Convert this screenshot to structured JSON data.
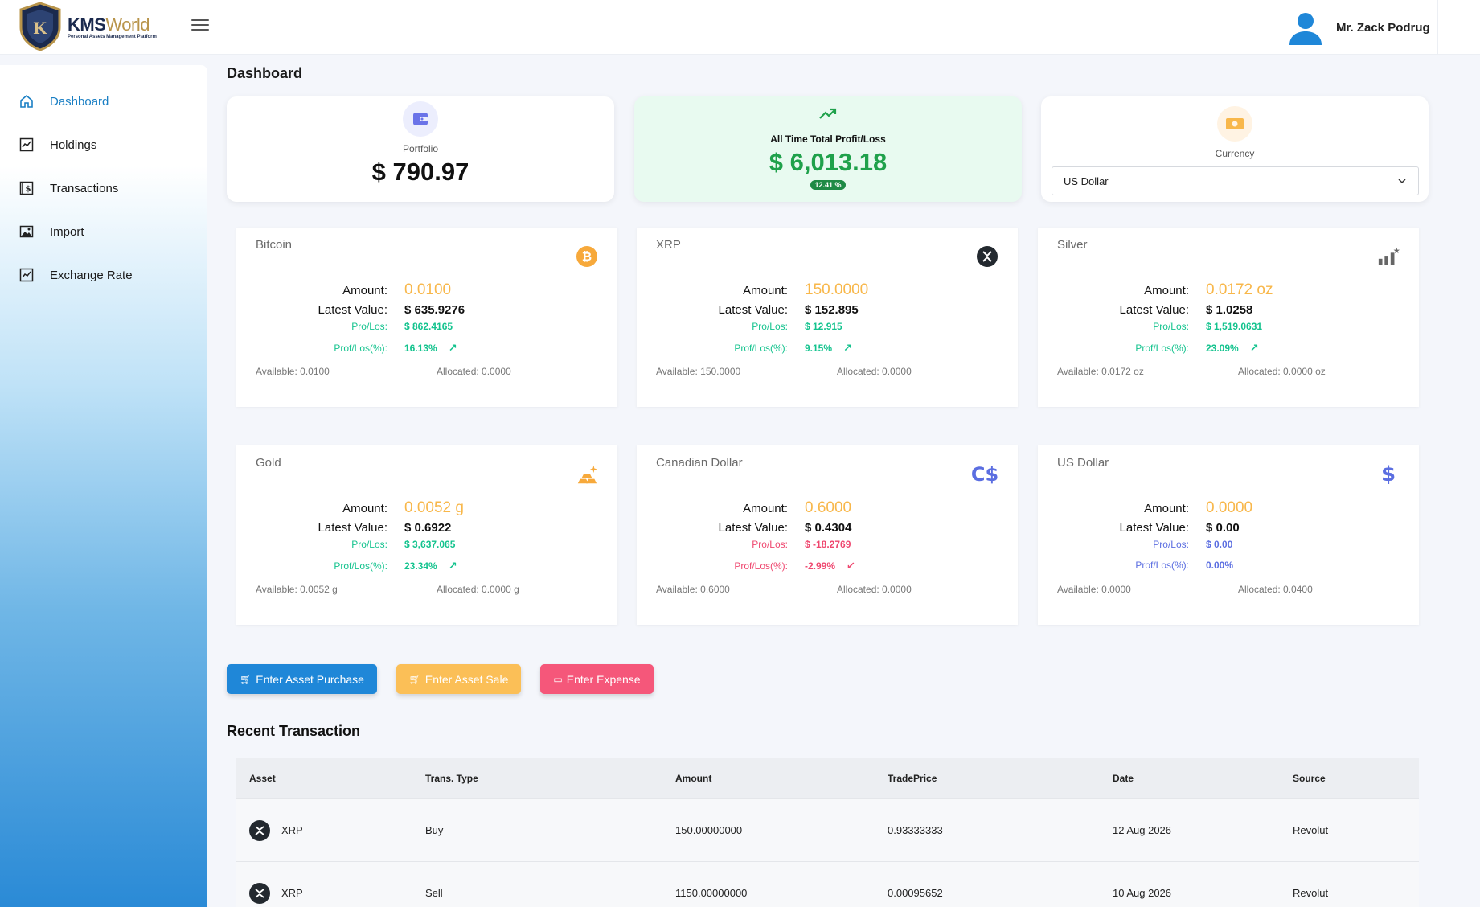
{
  "header": {
    "logo_title_main": "KMS",
    "logo_title_accent": "World",
    "logo_subtitle": "Personal Assets Management Platform",
    "user_name": "Mr. Zack Podrug"
  },
  "sidebar": {
    "items": [
      {
        "label": "Dashboard",
        "icon": "home-icon",
        "active": true
      },
      {
        "label": "Holdings",
        "icon": "chart-line-icon"
      },
      {
        "label": "Transactions",
        "icon": "receipt-dollar-icon"
      },
      {
        "label": "Import",
        "icon": "image-icon"
      },
      {
        "label": "Exchange Rate",
        "icon": "chart-line-icon"
      }
    ]
  },
  "main": {
    "title": "Dashboard",
    "portfolio": {
      "label": "Portfolio",
      "value": "$ 790.97",
      "icon": "wallet-icon"
    },
    "profit": {
      "label": "All Time Total Profit/Loss",
      "value": "$ 6,013.18",
      "badge": "12.41 %",
      "icon": "trending-up-icon"
    },
    "currency": {
      "label": "Currency",
      "selected": "US Dollar",
      "icon": "banknote-icon"
    },
    "labels": {
      "amount": "Amount:",
      "latest": "Latest Value:",
      "pl": "Pro/Los:",
      "plp": "Prof/Los(%):"
    },
    "assets": [
      {
        "name": "Bitcoin",
        "icon": "bitcoin-icon",
        "amount": "0.0100",
        "latest": "$ 635.9276",
        "pl": "$ 862.4165",
        "plp": "16.13%",
        "trend": "up",
        "available": "Available: 0.0100",
        "allocated": "Allocated: 0.0000"
      },
      {
        "name": "XRP",
        "icon": "xrp-icon",
        "amount": "150.0000",
        "latest": "$ 152.895",
        "pl": "$ 12.915",
        "plp": "9.15%",
        "trend": "up",
        "available": "Available: 150.0000",
        "allocated": "Allocated: 0.0000"
      },
      {
        "name": "Silver",
        "icon": "silver-chart-icon",
        "amount": "0.0172 oz",
        "latest": "$ 1.0258",
        "pl": "$ 1,519.0631",
        "plp": "23.09%",
        "trend": "up",
        "available": "Available: 0.0172 oz",
        "allocated": "Allocated: 0.0000 oz"
      },
      {
        "name": "Gold",
        "icon": "gold-bars-icon",
        "amount": "0.0052 g",
        "latest": "$ 0.6922",
        "pl": "$ 3,637.065",
        "plp": "23.34%",
        "trend": "up",
        "available": "Available: 0.0052 g",
        "allocated": "Allocated: 0.0000 g"
      },
      {
        "name": "Canadian Dollar",
        "icon": "cad-icon",
        "amount": "0.6000",
        "latest": "$ 0.4304",
        "pl": "$ -18.2769",
        "plp": "-2.99%",
        "trend": "down",
        "available": "Available: 0.6000",
        "allocated": "Allocated: 0.0000"
      },
      {
        "name": "US Dollar",
        "icon": "usd-icon",
        "amount": "0.0000",
        "latest": "$ 0.00",
        "pl": "$ 0.00",
        "plp": "0.00%",
        "trend": "none",
        "available": "Available: 0.0000",
        "allocated": "Allocated: 0.0400"
      }
    ],
    "buttons": {
      "purchase": "Enter Asset Purchase",
      "sale": "Enter Asset Sale",
      "expense": "Enter Expense"
    },
    "recent": {
      "title": "Recent Transaction",
      "columns": [
        "Asset",
        "Trans. Type",
        "Amount",
        "TradePrice",
        "Date",
        "Source"
      ],
      "rows": [
        {
          "asset": "XRP",
          "type": "Buy",
          "amount": "150.00000000",
          "price": "0.93333333",
          "date": "12 Aug 2026",
          "source": "Revolut"
        },
        {
          "asset": "XRP",
          "type": "Sell",
          "amount": "1150.00000000",
          "price": "0.00095652",
          "date": "10 Aug 2026",
          "source": "Revolut"
        }
      ]
    }
  },
  "colors": {
    "primary": "#1f87d8",
    "amount": "#f8b74a",
    "positive": "#14c38e",
    "negative": "#ef476f",
    "neutral": "#5b6ee1",
    "profit_value": "#1fa14b"
  }
}
